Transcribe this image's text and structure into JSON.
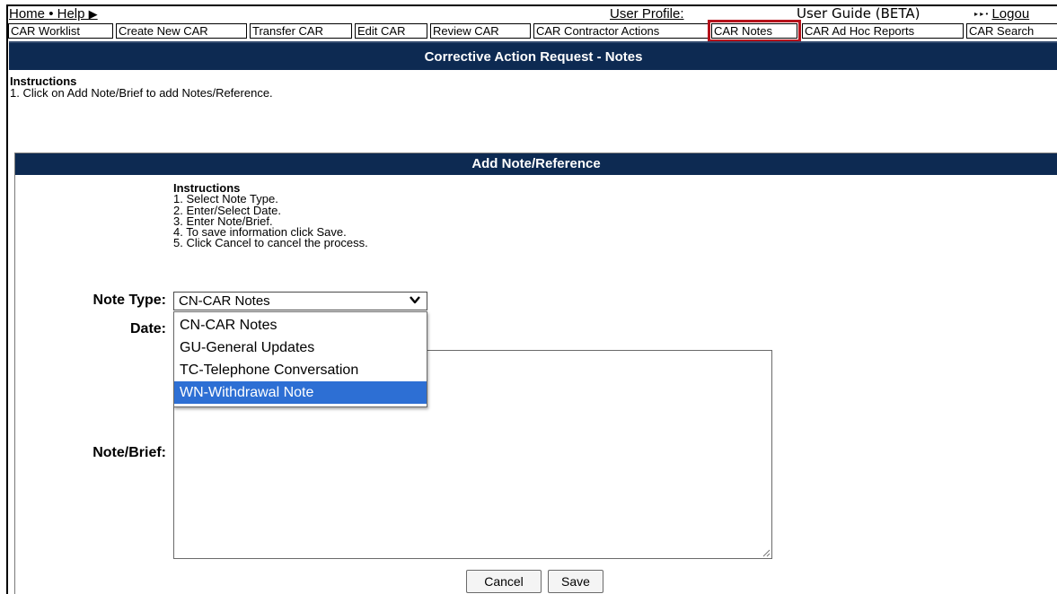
{
  "topbar": {
    "home": "Home",
    "separator": "•",
    "help": "Help",
    "help_arrow": "▶",
    "user_profile": "User Profile:",
    "user_guide": "User Guide (BETA)",
    "logout_prefix": "▸ ▸ •",
    "logout": "Logou"
  },
  "nav": {
    "tabs": [
      {
        "label": "CAR Worklist"
      },
      {
        "label": "Create New CAR"
      },
      {
        "label": "Transfer CAR"
      },
      {
        "label": "Edit CAR"
      },
      {
        "label": "Review CAR"
      },
      {
        "label": "CAR Contractor Actions"
      },
      {
        "label": "CAR Notes"
      },
      {
        "label": "CAR Ad Hoc Reports"
      },
      {
        "label": "CAR Search"
      }
    ],
    "active_tab": "CAR Notes",
    "highlight_color": "#b5121b"
  },
  "page": {
    "title": "Corrective Action Request - Notes",
    "instructions_heading": "Instructions",
    "instructions": [
      "1. Click on Add Note/Brief to add Notes/Reference."
    ]
  },
  "form": {
    "header": "Add Note/Reference",
    "instructions_heading": "Instructions",
    "instructions": [
      "1. Select Note Type.",
      "2. Enter/Select Date.",
      "3. Enter Note/Brief.",
      "4. To save information click Save.",
      "5. Click Cancel to cancel the process."
    ],
    "note_type_label": "Note Type:",
    "note_type_value": "CN-CAR Notes",
    "date_label": "Date:",
    "note_brief_label": "Note/Brief:",
    "note_brief_value": "",
    "dropdown_open": true,
    "dropdown_options": [
      {
        "label": "CN-CAR Notes"
      },
      {
        "label": "GU-General Updates"
      },
      {
        "label": "TC-Telephone Conversation"
      },
      {
        "label": "WN-Withdrawal Note"
      }
    ],
    "highlighted_option": "WN-Withdrawal Note",
    "cancel_label": "Cancel",
    "save_label": "Save"
  },
  "colors": {
    "header_bg": "#0d2a52",
    "option_highlight": "#2d6fd4"
  }
}
